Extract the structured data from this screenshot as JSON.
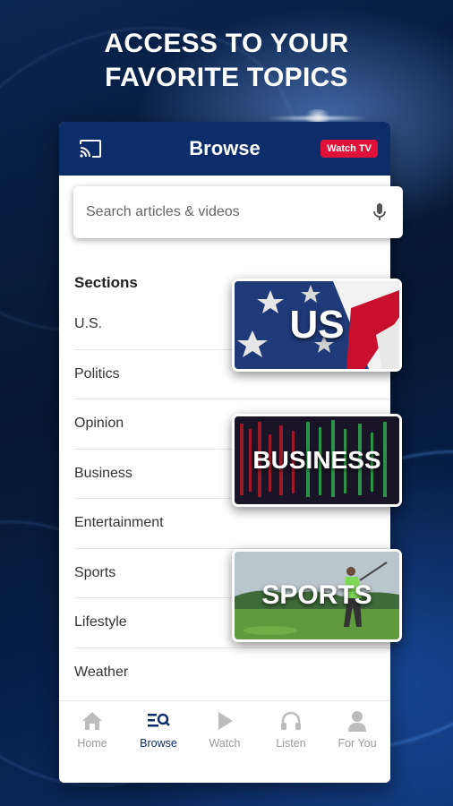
{
  "headline": {
    "line1": "ACCESS TO YOUR",
    "line2": "FAVORITE TOPICS"
  },
  "app": {
    "title": "Browse",
    "watch_tv_label": "Watch TV",
    "cast_icon": "cast-icon"
  },
  "search": {
    "placeholder": "Search articles & videos",
    "value": "",
    "mic_icon": "microphone-icon"
  },
  "sections": {
    "title": "Sections",
    "items": [
      "U.S.",
      "Politics",
      "Opinion",
      "Business",
      "Entertainment",
      "Sports",
      "Lifestyle",
      "Weather"
    ]
  },
  "bottom_nav": {
    "items": [
      {
        "label": "Home",
        "icon": "home-icon",
        "active": false
      },
      {
        "label": "Browse",
        "icon": "browse-icon",
        "active": true
      },
      {
        "label": "Watch",
        "icon": "play-icon",
        "active": false
      },
      {
        "label": "Listen",
        "icon": "headphones-icon",
        "active": false
      },
      {
        "label": "For You",
        "icon": "person-icon",
        "active": false
      }
    ]
  },
  "topic_cards": [
    {
      "label": "US"
    },
    {
      "label": "BUSINESS"
    },
    {
      "label": "SPORTS"
    }
  ],
  "colors": {
    "header_navy": "#0c2c6a",
    "watch_tv_red": "#e1123a",
    "active_nav": "#0c2c6a",
    "inactive_nav": "#999999"
  }
}
